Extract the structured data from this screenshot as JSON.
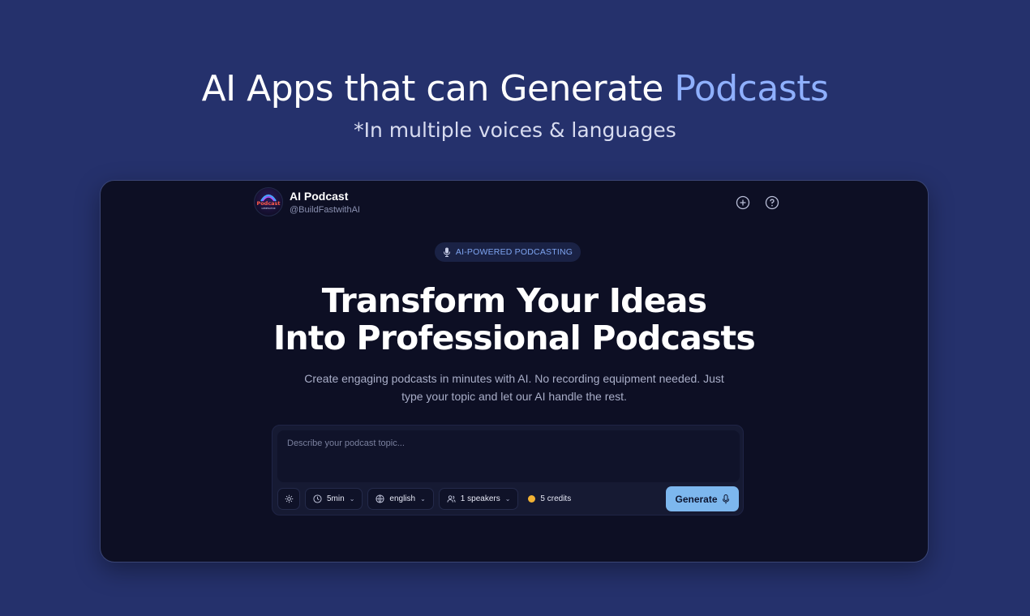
{
  "hero": {
    "title_main": "AI Apps that can Generate",
    "title_accent": "Podcasts",
    "subtitle": "*In multiple voices & languages"
  },
  "app": {
    "name": "AI Podcast",
    "handle": "@BuildFastwithAI",
    "logo_text_top": "Podcast",
    "logo_text_bottom": "GENERATOR",
    "top_icons": [
      "plus-circle-icon",
      "help-circle-icon"
    ]
  },
  "badge": {
    "icon": "microphone-icon",
    "label": "AI-POWERED PODCASTING"
  },
  "headline": {
    "line1": "Transform Your Ideas",
    "line2": "Into Professional Podcasts"
  },
  "description": "Create engaging podcasts in minutes with AI. No recording equipment needed. Just type your topic and let our AI handle the rest.",
  "composer": {
    "placeholder": "Describe your podcast topic...",
    "value": "",
    "settings_icon": "gear-icon",
    "duration": "5min",
    "language": "english",
    "speakers": "1 speakers",
    "credits": "5 credits",
    "generate_label": "Generate"
  },
  "colors": {
    "background": "#25316c",
    "accent": "#8fb0ff",
    "window": "#0d0f24",
    "generate_button": "#7db7ee",
    "credits_dot": "#f2b234"
  }
}
